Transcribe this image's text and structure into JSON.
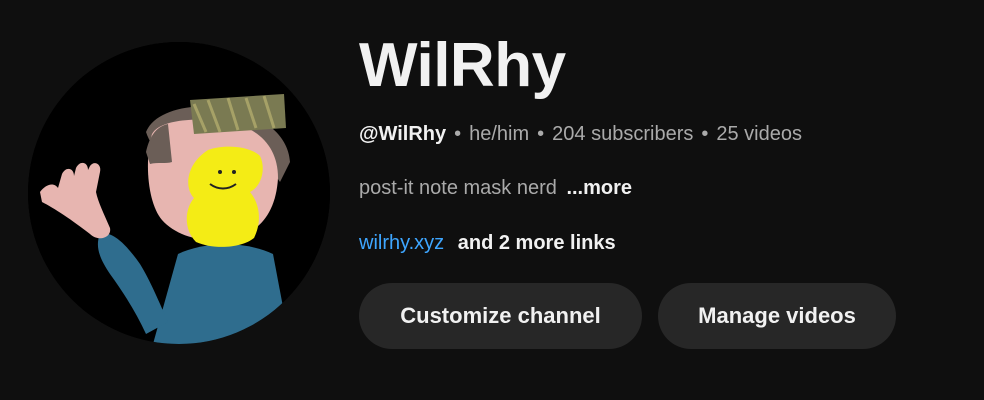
{
  "channel": {
    "title": "WilRhy",
    "handle": "@WilRhy",
    "pronouns": "he/him",
    "subscribers": "204 subscribers",
    "videos": "25 videos",
    "separator": "•",
    "description": "post-it note mask nerd",
    "more_label": "...more",
    "link_text": "wilrhy.xyz",
    "more_links_text": "and 2 more links"
  },
  "actions": {
    "customize_label": "Customize channel",
    "manage_label": "Manage videos"
  },
  "colors": {
    "background": "#0f0f0f",
    "button_bg": "#272727",
    "link": "#3ea6ff",
    "primary_text": "#f1f1f1",
    "secondary_text": "#aaaaaa"
  }
}
